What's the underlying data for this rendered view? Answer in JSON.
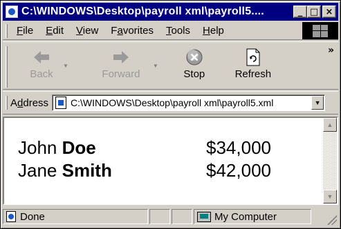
{
  "window": {
    "title": "C:\\WINDOWS\\Desktop\\payroll xml\\payroll5....",
    "minimize_glyph": "_",
    "maximize_glyph": "□",
    "close_glyph": "×"
  },
  "menu": {
    "items": [
      {
        "prefix": "",
        "accel": "F",
        "rest": "ile"
      },
      {
        "prefix": "",
        "accel": "E",
        "rest": "dit"
      },
      {
        "prefix": "",
        "accel": "V",
        "rest": "iew"
      },
      {
        "prefix": "F",
        "accel": "a",
        "rest": "vorites"
      },
      {
        "prefix": "",
        "accel": "T",
        "rest": "ools"
      },
      {
        "prefix": "",
        "accel": "H",
        "rest": "elp"
      }
    ]
  },
  "toolbar": {
    "back_label": "Back",
    "forward_label": "Forward",
    "stop_label": "Stop",
    "refresh_label": "Refresh",
    "more_glyph": "»"
  },
  "address": {
    "label_prefix": "A",
    "label_accel": "d",
    "label_rest": "dress",
    "value": "C:\\WINDOWS\\Desktop\\payroll xml\\payroll5.xml"
  },
  "content": {
    "rows": [
      {
        "first": "John",
        "last": "Doe",
        "salary": "$34,000"
      },
      {
        "first": "Jane",
        "last": "Smith",
        "salary": "$42,000"
      }
    ]
  },
  "status": {
    "text": "Done",
    "zone": "My Computer"
  },
  "icons": {
    "title": "ie-page-icon",
    "back": "arrow-left-icon",
    "forward": "arrow-right-icon",
    "stop": "stop-icon",
    "refresh": "refresh-icon",
    "address_page": "page-icon",
    "status_done": "page-done-icon",
    "status_zone": "computer-icon"
  }
}
